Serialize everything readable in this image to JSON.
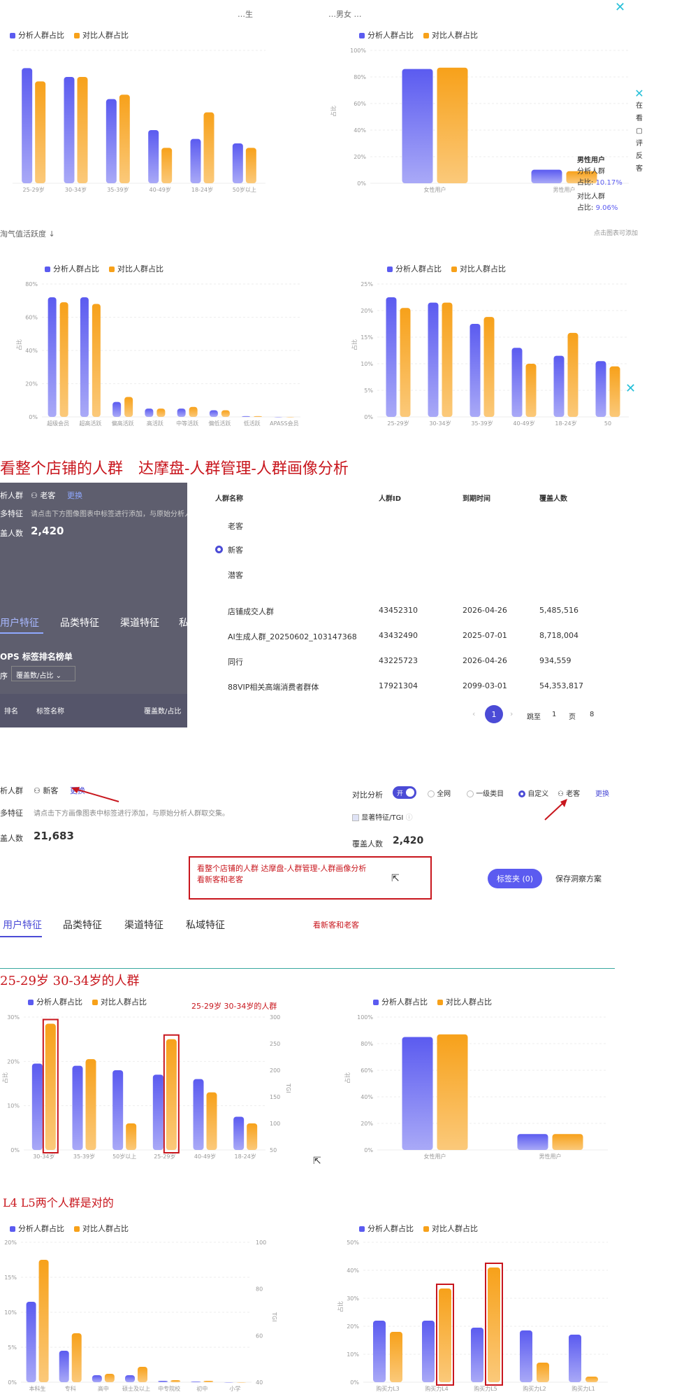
{
  "colors": {
    "analysis": "#5b5bf0",
    "compare": "#f7a11a",
    "red": "#c8161d",
    "accent": "#4b4bd6"
  },
  "legend": {
    "analysis": "分析人群占比",
    "compare": "对比人群占比"
  },
  "top_cutoff": {
    "left": "…生",
    "right": "…男女 …"
  },
  "section1_footer": {
    "left": "淘气值活跃度 ↓",
    "right": "点击图表可添加"
  },
  "tooltip": {
    "title": "男性用户",
    "analysis_label": "分析人群",
    "analysis_label2": "占比:",
    "analysis_value": "10.17%",
    "compare_label": "对比人群",
    "compare_label2": "占比:",
    "compare_value": "9.06%"
  },
  "side_widget": {
    "line1": "在",
    "line2": "看",
    "line3": "评",
    "line4": "反",
    "line5": "客"
  },
  "heading_store": "看整个店铺的人群　达摩盘-人群管理-人群画像分析",
  "dark_panel": {
    "row1_label": "析人群",
    "row1_value": "老客",
    "row1_link": "更换",
    "row2_label": "多特征",
    "row2_text": "请点击下方图像图表中标签进行添加，与原始分析人",
    "row3_label": "盖人数",
    "row3_value": "2,420",
    "tabs": [
      "用户特征",
      "品类特征",
      "渠道特征",
      "私"
    ],
    "list_title": "OPS 标签排名榜单",
    "sort_label": "序",
    "sort_value": "覆盖数/占比",
    "col1": "排名",
    "col2": "标签名称",
    "col3": "覆盖数/占比"
  },
  "crowd_table": {
    "headers": [
      "人群名称",
      "人群ID",
      "到期时间",
      "覆盖人数"
    ],
    "rows": [
      {
        "name": "老客",
        "id": "",
        "expire": "",
        "count": ""
      },
      {
        "name": "新客",
        "id": "",
        "expire": "",
        "count": ""
      },
      {
        "name": "潜客",
        "id": "",
        "expire": "",
        "count": ""
      },
      {
        "name": "店铺成交人群",
        "id": "43452310",
        "expire": "2026-04-26",
        "count": "5,485,516"
      },
      {
        "name": "AI生成人群_20250602_103147368",
        "id": "43432490",
        "expire": "2025-07-01",
        "count": "8,718,004"
      },
      {
        "name": "同行",
        "id": "43225723",
        "expire": "2026-04-26",
        "count": "934,559"
      },
      {
        "name": "88VIP相关高端消费者群体",
        "id": "17921304",
        "expire": "2099-03-01",
        "count": "54,353,817"
      }
    ],
    "pagination": {
      "page": "1",
      "jump": "跳至",
      "page_input": "1",
      "page_suffix": "页",
      "go": "8"
    }
  },
  "analysis_bar": {
    "left_label": "析人群",
    "left_value": "新客",
    "left_link": "更换",
    "features_label": "多特征",
    "features_text": "请点击下方画像图表中标签进行添加，与原始分析人群取交集。",
    "count_label": "盖人数",
    "count_value": "21,683",
    "compare_label": "对比分析",
    "toggle": "开",
    "opt_all": "全网",
    "opt_cat": "一级类目",
    "opt_custom": "自定义",
    "compare_crowd": "老客",
    "compare_link": "更换",
    "tgi_label": "显著特征/TGI",
    "compare_count_label": "覆盖人数",
    "compare_count_value": "2,420",
    "tag_btn": "标签夹 (0)",
    "save_btn": "保存洞察方案"
  },
  "annotation_box": {
    "line1": "看整个店铺的人群  达摩盘-人群管理-人群画像分析",
    "line2": "看新客和老客"
  },
  "tabs2": [
    "用户特征",
    "品类特征",
    "渠道特征",
    "私域特征"
  ],
  "tabs2_note": "看新客和老客",
  "heading_age": "25-29岁  30-34岁的人群",
  "age_note": "25-29岁 30-34岁的人群",
  "heading_l45": "L4   L5两个人群是对的",
  "chart_data": [
    {
      "type": "bar",
      "categories": [
        "25-29岁",
        "30-34岁",
        "35-39岁",
        "40-49岁",
        "18-24岁",
        "50岁以上"
      ],
      "series": [
        {
          "name": "分析人群占比",
          "values": [
            26,
            24,
            19,
            12,
            10,
            9
          ]
        },
        {
          "name": "对比人群占比",
          "values": [
            23,
            24,
            20,
            8,
            16,
            8
          ]
        }
      ],
      "ylim": [
        0,
        30
      ]
    },
    {
      "type": "bar",
      "categories": [
        "女性用户",
        "男性用户"
      ],
      "series": [
        {
          "name": "分析人群占比",
          "values": [
            86,
            10.17
          ]
        },
        {
          "name": "对比人群占比",
          "values": [
            87,
            9.06
          ]
        }
      ],
      "ylim": [
        0,
        100
      ],
      "yticks": [
        "0%",
        "20%",
        "40%",
        "60%",
        "80%",
        "100%"
      ],
      "ylabel": "占比"
    },
    {
      "type": "bar",
      "categories": [
        "超级会员",
        "超高活跃",
        "偏高活跃",
        "高活跃",
        "中等活跃",
        "偏低活跃",
        "低活跃",
        "APASS会员"
      ],
      "series": [
        {
          "name": "分析人群占比",
          "values": [
            72,
            72,
            9,
            5,
            5,
            4,
            0.5,
            0
          ]
        },
        {
          "name": "对比人群占比",
          "values": [
            69,
            68,
            12,
            5,
            6,
            4,
            0.5,
            0
          ]
        }
      ],
      "ylim": [
        0,
        80
      ],
      "yticks": [
        "0%",
        "20%",
        "40%",
        "60%",
        "80%"
      ],
      "ylabel": "占比"
    },
    {
      "type": "bar",
      "categories": [
        "25-29岁",
        "30-34岁",
        "35-39岁",
        "40-49岁",
        "18-24岁",
        "50"
      ],
      "series": [
        {
          "name": "分析人群占比",
          "values": [
            22.5,
            21.5,
            17.5,
            13,
            11.5,
            10.5
          ]
        },
        {
          "name": "对比人群占比",
          "values": [
            20.5,
            21.5,
            18.8,
            10,
            15.8,
            9.5
          ]
        }
      ],
      "ylim": [
        0,
        25
      ],
      "yticks": [
        "0%",
        "5%",
        "10%",
        "15%",
        "20%",
        "25%"
      ],
      "ylabel": "占比"
    },
    {
      "type": "bar",
      "categories": [
        "30-34岁",
        "35-39岁",
        "50岁以上",
        "25-29岁",
        "40-49岁",
        "18-24岁"
      ],
      "series": [
        {
          "name": "分析人群占比",
          "values": [
            19.5,
            19,
            18,
            17,
            16,
            7.5
          ]
        },
        {
          "name": "对比人群占比",
          "values": [
            28.5,
            20.5,
            6,
            25,
            13,
            6
          ]
        }
      ],
      "ylim": [
        0,
        30
      ],
      "yticks": [
        "0%",
        "10%",
        "20%",
        "30%"
      ],
      "ylabel": "占比",
      "y2label": "TGI",
      "y2ticks": [
        "50",
        "100",
        "150",
        "200",
        "250",
        "300"
      ]
    },
    {
      "type": "bar",
      "categories": [
        "女性用户",
        "男性用户"
      ],
      "series": [
        {
          "name": "分析人群占比",
          "values": [
            85,
            12
          ]
        },
        {
          "name": "对比人群占比",
          "values": [
            87,
            12
          ]
        }
      ],
      "ylim": [
        0,
        100
      ],
      "yticks": [
        "0%",
        "20%",
        "40%",
        "60%",
        "80%",
        "100%"
      ],
      "ylabel": "占比"
    },
    {
      "type": "bar",
      "categories": [
        "本科生",
        "专科",
        "高中",
        "硕士及以上",
        "中专院校",
        "初中",
        "小学"
      ],
      "series": [
        {
          "name": "分析人群占比",
          "values": [
            11.5,
            4.5,
            1,
            1,
            0.2,
            0.1,
            0
          ]
        },
        {
          "name": "对比人群占比",
          "values": [
            17.5,
            7,
            1.2,
            2.2,
            0.3,
            0.2,
            0
          ]
        }
      ],
      "ylim": [
        0,
        20
      ],
      "yticks": [
        "0%",
        "5%",
        "10%",
        "15%",
        "20%"
      ],
      "y2label": "TGI",
      "y2ticks": [
        "40",
        "60",
        "80",
        "100"
      ]
    },
    {
      "type": "bar",
      "categories": [
        "购买力L3",
        "购买力L4",
        "购买力L5",
        "购买力L2",
        "购买力L1"
      ],
      "series": [
        {
          "name": "分析人群占比",
          "values": [
            22,
            22,
            19.5,
            18.5,
            17
          ]
        },
        {
          "name": "对比人群占比",
          "values": [
            18,
            33.5,
            41,
            7,
            2
          ]
        }
      ],
      "ylim": [
        0,
        50
      ],
      "yticks": [
        "0%",
        "10%",
        "20%",
        "30%",
        "40%",
        "50%"
      ],
      "ylabel": "占比"
    }
  ]
}
